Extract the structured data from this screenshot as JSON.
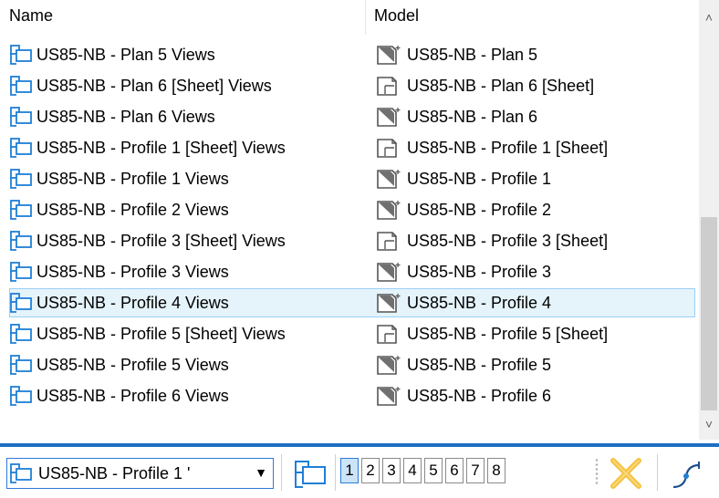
{
  "header": {
    "name": "Name",
    "model": "Model"
  },
  "rows": [
    {
      "name": "US85-NB - Plan 5 Views",
      "model": "US85-NB - Plan 5",
      "model_type": "design"
    },
    {
      "name": "US85-NB - Plan 6 [Sheet] Views",
      "model": "US85-NB - Plan 6 [Sheet]",
      "model_type": "sheet"
    },
    {
      "name": "US85-NB - Plan 6 Views",
      "model": "US85-NB - Plan 6",
      "model_type": "design"
    },
    {
      "name": "US85-NB - Profile 1 [Sheet] Views",
      "model": "US85-NB - Profile 1 [Sheet]",
      "model_type": "sheet"
    },
    {
      "name": "US85-NB - Profile 1 Views",
      "model": "US85-NB - Profile 1",
      "model_type": "design"
    },
    {
      "name": "US85-NB - Profile 2 Views",
      "model": "US85-NB - Profile 2",
      "model_type": "design"
    },
    {
      "name": "US85-NB - Profile 3 [Sheet] Views",
      "model": "US85-NB - Profile 3 [Sheet]",
      "model_type": "sheet"
    },
    {
      "name": "US85-NB - Profile 3 Views",
      "model": "US85-NB - Profile 3",
      "model_type": "design"
    },
    {
      "name": "US85-NB - Profile 4 Views",
      "model": "US85-NB - Profile 4",
      "model_type": "design",
      "selected": true
    },
    {
      "name": "US85-NB - Profile 5 [Sheet] Views",
      "model": "US85-NB - Profile 5 [Sheet]",
      "model_type": "sheet"
    },
    {
      "name": "US85-NB - Profile 5 Views",
      "model": "US85-NB - Profile 5",
      "model_type": "design"
    },
    {
      "name": "US85-NB - Profile 6 Views",
      "model": "US85-NB - Profile 6",
      "model_type": "design"
    }
  ],
  "toolbar": {
    "combo_value": "US85-NB - Profile 1 '",
    "views": [
      "1",
      "2",
      "3",
      "4",
      "5",
      "6",
      "7",
      "8"
    ],
    "active_view": "1"
  },
  "icons": {
    "saved_view": "saved-view-icon",
    "design_model": "design-model-icon",
    "sheet_model": "sheet-model-icon",
    "close": "close-x-icon",
    "tool": "apply-tool-icon"
  },
  "colors": {
    "accent": "#1e6fc1",
    "selection": "#e5f3fb",
    "close_x": "#f5c242"
  }
}
